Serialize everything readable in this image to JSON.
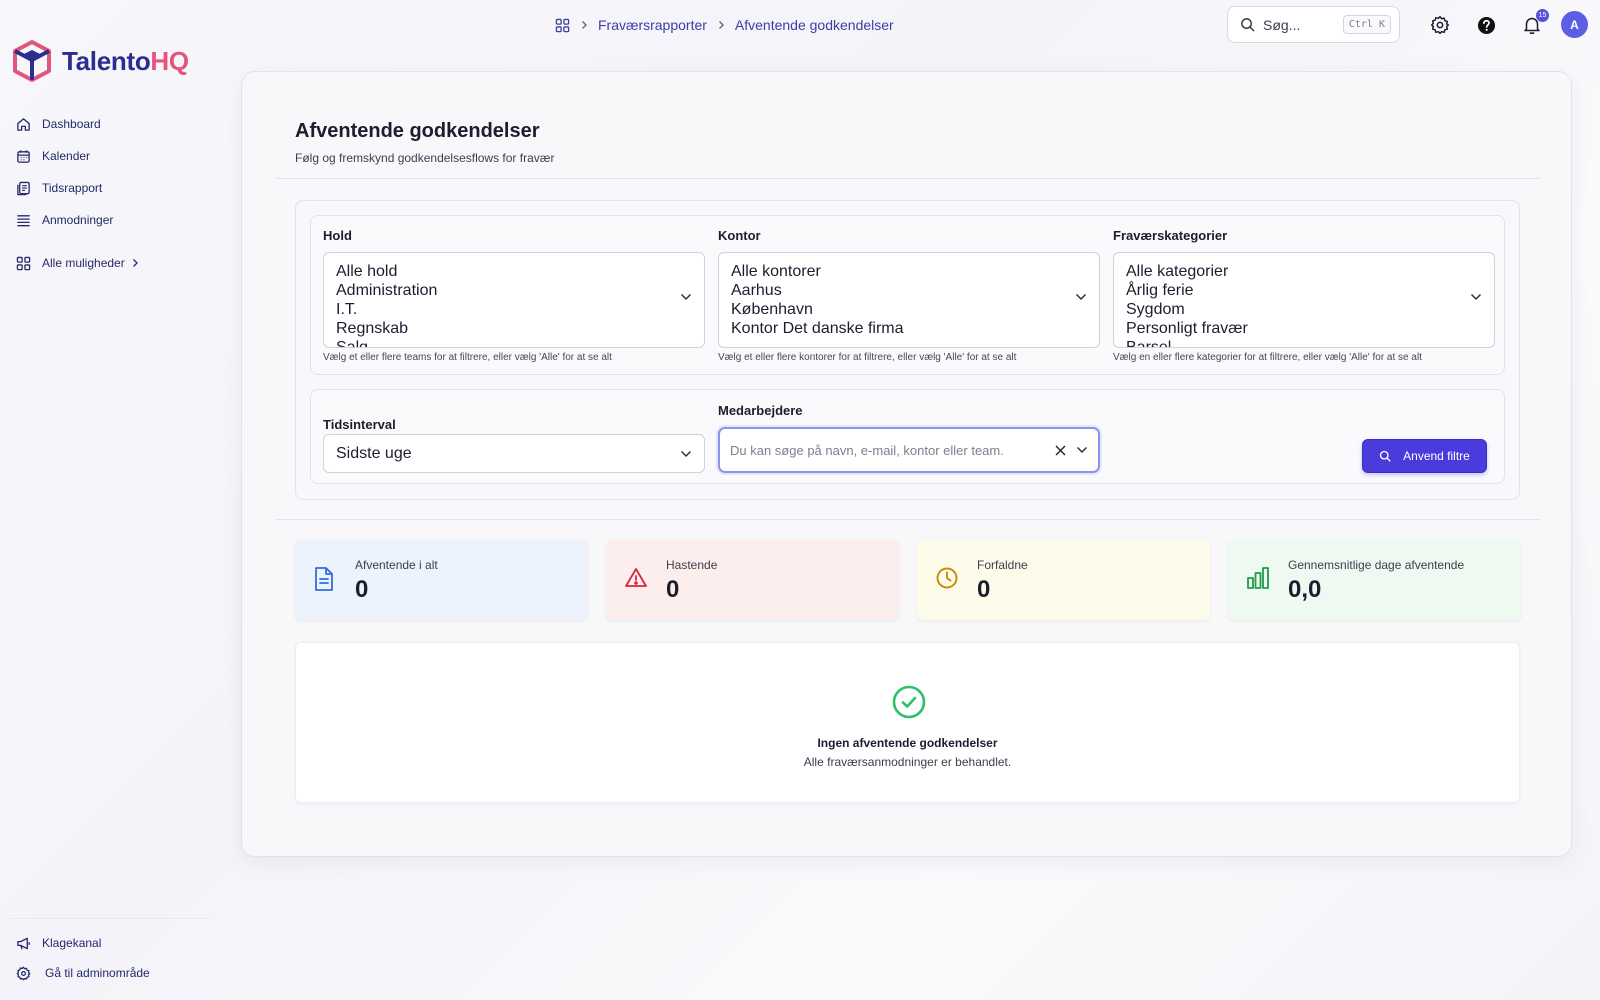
{
  "brand": {
    "name_part1": "Talento",
    "name_part2": "HQ",
    "color_primary": "#2b2d8f",
    "color_accent": "#e3557a"
  },
  "sidebar": {
    "items": [
      {
        "label": "Dashboard",
        "icon": "home-icon"
      },
      {
        "label": "Kalender",
        "icon": "calendar-icon"
      },
      {
        "label": "Tidsrapport",
        "icon": "timesheet-icon"
      },
      {
        "label": "Anmodninger",
        "icon": "list-icon"
      }
    ],
    "all_options": "Alle muligheder",
    "bottom": [
      {
        "label": "Klagekanal",
        "icon": "megaphone-icon"
      },
      {
        "label": "Gå til adminområde",
        "icon": "gear-icon"
      }
    ]
  },
  "breadcrumb": {
    "items": [
      "Fraværsrapporter",
      "Afventende godkendelser"
    ]
  },
  "search": {
    "placeholder": "Søg...",
    "shortcut": "Ctrl K"
  },
  "notifications": {
    "count": "15"
  },
  "user": {
    "initial": "A"
  },
  "page": {
    "title": "Afventende godkendelser",
    "subtitle": "Følg og fremskynd godkendelsesflows for fravær"
  },
  "filters": {
    "teams": {
      "label": "Hold",
      "options": [
        "Alle hold",
        "Administration",
        "I.T.",
        "Regnskab",
        "Salg"
      ],
      "help": "Vælg et eller flere teams for at filtrere, eller vælg 'Alle' for at se alt"
    },
    "offices": {
      "label": "Kontor",
      "options": [
        "Alle kontorer",
        "Aarhus",
        "København",
        "Kontor Det danske firma"
      ],
      "help": "Vælg et eller flere kontorer for at filtrere, eller vælg 'Alle' for at se alt"
    },
    "categories": {
      "label": "Fraværskategorier",
      "options": [
        "Alle kategorier",
        "Årlig ferie",
        "Sygdom",
        "Personligt fravær",
        "Barsel"
      ],
      "help": "Vælg en eller flere kategorier for at filtrere, eller vælg 'Alle' for at se alt"
    },
    "interval": {
      "label": "Tidsinterval",
      "value": "Sidste uge"
    },
    "employees": {
      "label": "Medarbejdere",
      "placeholder": "Du kan søge på navn, e-mail, kontor eller team."
    },
    "apply_label": "Anvend filtre"
  },
  "stats": [
    {
      "label": "Afventende i alt",
      "value": "0",
      "icon": "document-icon",
      "bg": "#edf3fd",
      "color": "#2f6fe0"
    },
    {
      "label": "Hastende",
      "value": "0",
      "icon": "warning-icon",
      "bg": "#fdeeee",
      "color": "#d4263a"
    },
    {
      "label": "Forfaldne",
      "value": "0",
      "icon": "clock-icon",
      "bg": "#fdfbea",
      "color": "#c98a06"
    },
    {
      "label": "Gennemsnitlige dage afventende",
      "value": "0,0",
      "icon": "bar-chart-icon",
      "bg": "#eefaf1",
      "color": "#1e9b4a"
    }
  ],
  "empty_state": {
    "title": "Ingen afventende godkendelser",
    "subtitle": "Alle fraværsanmodninger er behandlet.",
    "icon": "check-circle-icon",
    "color": "#2fbf6b"
  }
}
